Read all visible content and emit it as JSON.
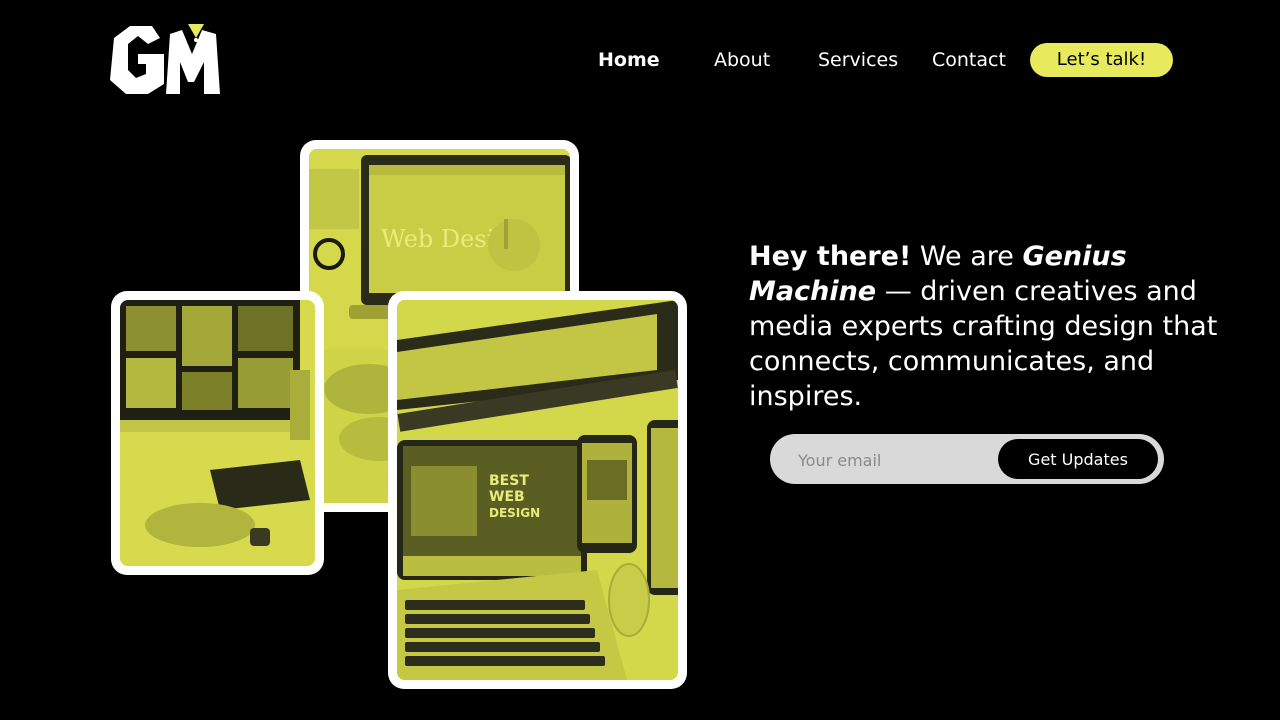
{
  "brand": {
    "logo_text": "GM",
    "accent_color": "#e6ea5c"
  },
  "nav": {
    "items": [
      {
        "label": "Home"
      },
      {
        "label": "About"
      },
      {
        "label": "Services"
      },
      {
        "label": "Contact"
      }
    ],
    "cta_label": "Let’s talk!"
  },
  "images": {
    "top": {
      "icon": "laptop-web-design-photo",
      "text": "Web Design."
    },
    "left": {
      "icon": "desk-computer-photo"
    },
    "front": {
      "icon": "devices-best-web-design-photo",
      "text_line1": "BEST",
      "text_line2": "WEB",
      "text_line3": "DESIGN"
    }
  },
  "hero": {
    "greeting": "Hey there!",
    "we_are": " We are ",
    "brand_name": "Genius Machine",
    "rest": " — driven creatives and media experts crafting design that connects, communicates, and inspires."
  },
  "subscribe": {
    "placeholder": "Your email",
    "button_label": "Get Updates"
  }
}
